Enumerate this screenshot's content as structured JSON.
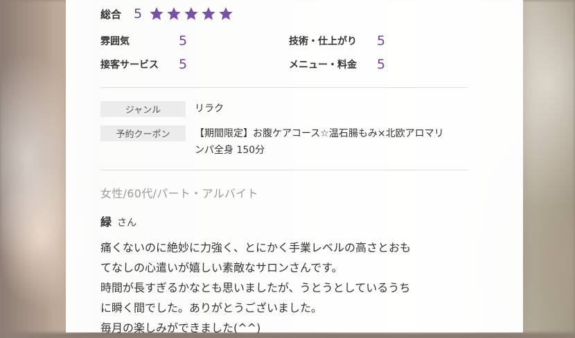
{
  "overall": {
    "label": "総合",
    "score": "5",
    "stars": 5,
    "star_color": "#7a4fa6"
  },
  "subscores": [
    {
      "label": "雰囲気",
      "value": "5"
    },
    {
      "label": "技術・仕上がり",
      "value": "5"
    },
    {
      "label": "接客サービス",
      "value": "5"
    },
    {
      "label": "メニュー・料金",
      "value": "5"
    }
  ],
  "info": {
    "genre_label": "ジャンル",
    "genre_value": "リラク",
    "coupon_label": "予約クーポン",
    "coupon_value_line1": "【期間限定】お腹ケアコース☆温石腸もみ×北欧アロマリ",
    "coupon_value_line2": "ンパ全身 150分"
  },
  "reviewer": {
    "meta": "女性/60代/パート・アルバイト",
    "name": "緑",
    "honorific": "さん"
  },
  "review_lines": [
    "痛くないのに絶妙に力強く、とにかく手業レベルの高さとおも",
    "てなしの心遣いが嬉しい素敵なサロンさんです。",
    "時間が長すぎるかなとも思いましたが、うとうとしているうち",
    "に瞬く間でした。ありがとうございました。",
    "毎月の楽しみができました(^^)"
  ],
  "colors": {
    "accent": "#6b4596"
  }
}
